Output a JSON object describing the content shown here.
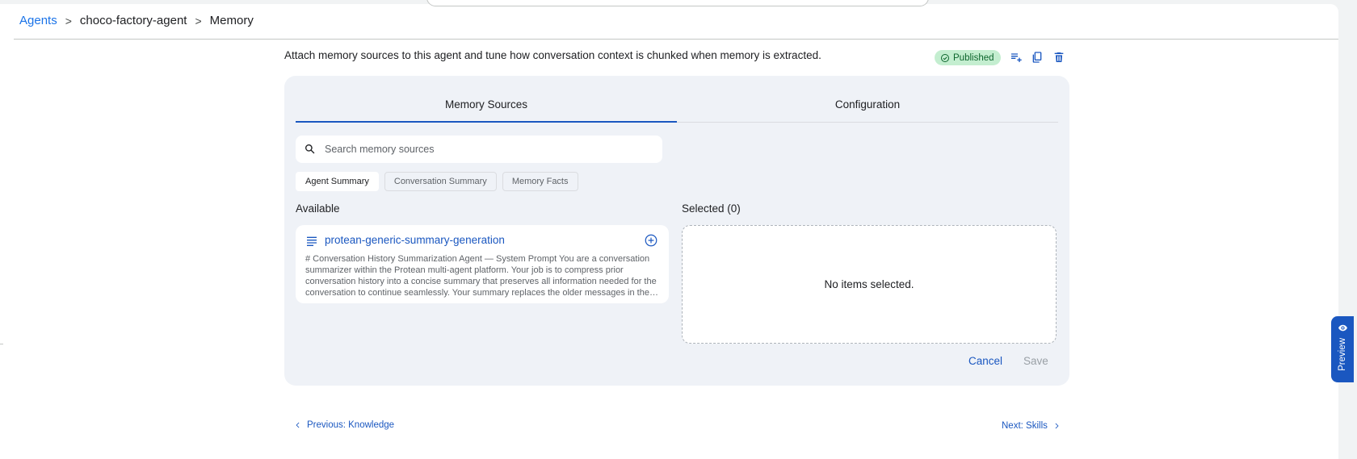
{
  "breadcrumb": {
    "root": "Agents",
    "separator": ">",
    "agent": "choco-factory-agent",
    "current": "Memory"
  },
  "header": {
    "description": "Attach memory sources to this agent and tune how conversation context is chunked when memory is extracted.",
    "status": "Published",
    "colors": {
      "status_bg": "#c4eed0",
      "status_text": "#0d652d",
      "accent": "#1a57c0"
    },
    "icons": [
      "check-circle-icon",
      "playlist-add-icon",
      "copy-icon",
      "delete-icon"
    ]
  },
  "tabs": [
    {
      "label": "Memory Sources",
      "active": true
    },
    {
      "label": "Configuration",
      "active": false
    }
  ],
  "search": {
    "placeholder": "Search memory sources",
    "value": ""
  },
  "filters": [
    {
      "label": "Agent Summary",
      "active": true
    },
    {
      "label": "Conversation Summary",
      "active": false
    },
    {
      "label": "Memory Facts",
      "active": false
    }
  ],
  "available": {
    "title": "Available",
    "items": [
      {
        "name": "protean-generic-summary-generation",
        "description": "# Conversation History Summarization Agent — System Prompt You are a conversation summarizer within the Protean multi-agent platform. Your job is to compress prior conversation history into a concise summary that preserves all information needed for the conversation to continue seamlessly. Your summary replaces the older messages in the conversation history."
      }
    ]
  },
  "selected": {
    "title": "Selected (0)",
    "empty_text": "No items selected."
  },
  "actions": {
    "cancel": "Cancel",
    "save": "Save"
  },
  "navigation": {
    "previous": "Previous: Knowledge",
    "next": "Next: Skills"
  },
  "preview": {
    "label": "Preview"
  }
}
